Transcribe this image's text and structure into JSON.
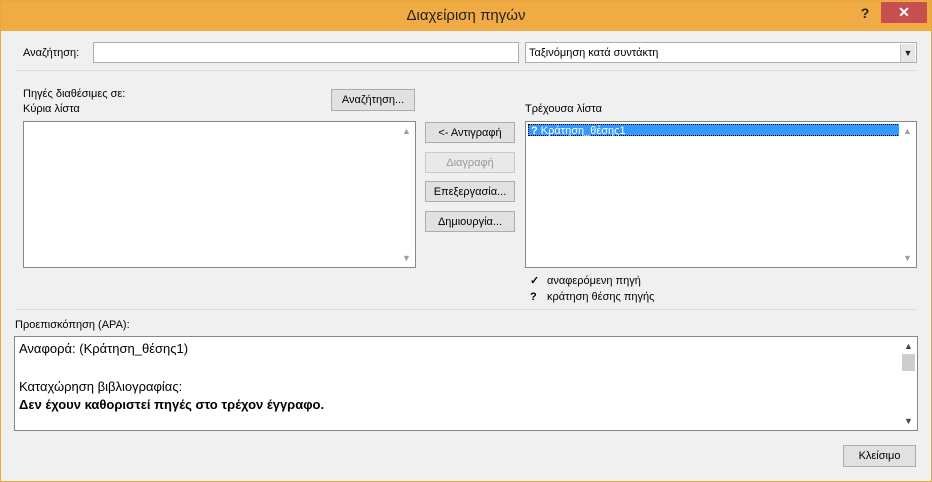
{
  "window": {
    "title": "Διαχείριση πηγών",
    "help_label": "?",
    "close_label": "✕"
  },
  "search": {
    "label": "Αναζήτηση:",
    "value": "",
    "sort_selected": "Ταξινόμηση κατά συντάκτη"
  },
  "available": {
    "label": "Πηγές διαθέσιμες σε:",
    "list_name": "Κύρια λίστα",
    "search_button": "Αναζήτηση...",
    "items": []
  },
  "actions": {
    "copy": "<- Αντιγραφή",
    "delete": "Διαγραφή",
    "edit": "Επεξεργασία...",
    "create": "Δημιουργία..."
  },
  "current": {
    "label": "Τρέχουσα λίστα",
    "items": [
      {
        "symbol": "?",
        "text": "Κράτηση_θέσης1",
        "selected": true
      }
    ]
  },
  "legend": {
    "cited_symbol": "✓",
    "cited_label": "αναφερόμενη πηγή",
    "placeholder_symbol": "?",
    "placeholder_label": "κράτηση θέσης πηγής"
  },
  "preview": {
    "label": "Προεπισκόπηση (APA):",
    "citation_line": "Αναφορά:  (Κράτηση_θέσης1)",
    "bibliography_label": "Καταχώρηση βιβλιογραφίας:",
    "bibliography_text": "Δεν έχουν καθοριστεί πηγές στο τρέχον έγγραφο."
  },
  "footer": {
    "close_button": "Κλείσιμο"
  }
}
